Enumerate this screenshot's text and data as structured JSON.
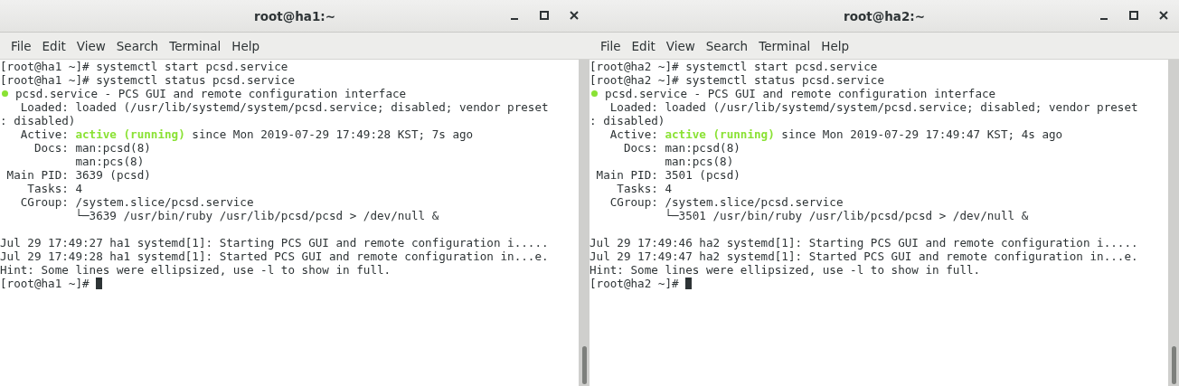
{
  "windows": [
    {
      "title": "root@ha1:~",
      "menu": [
        "File",
        "Edit",
        "View",
        "Search",
        "Terminal",
        "Help"
      ],
      "lines": [
        {
          "kind": "plain",
          "text": "[root@ha1 ~]# systemctl start pcsd.service"
        },
        {
          "kind": "plain",
          "text": "[root@ha1 ~]# systemctl status pcsd.service"
        },
        {
          "kind": "bullet",
          "text": "pcsd.service - PCS GUI and remote configuration interface"
        },
        {
          "kind": "plain",
          "text": "   Loaded: loaded (/usr/lib/systemd/system/pcsd.service; disabled; vendor preset"
        },
        {
          "kind": "plain",
          "text": ": disabled)"
        },
        {
          "kind": "status",
          "label": "   Active: ",
          "state": "active (running)",
          "rest": " since Mon 2019-07-29 17:49:28 KST; 7s ago"
        },
        {
          "kind": "plain",
          "text": "     Docs: man:pcsd(8)"
        },
        {
          "kind": "plain",
          "text": "           man:pcs(8)"
        },
        {
          "kind": "plain",
          "text": " Main PID: 3639 (pcsd)"
        },
        {
          "kind": "plain",
          "text": "    Tasks: 4"
        },
        {
          "kind": "plain",
          "text": "   CGroup: /system.slice/pcsd.service"
        },
        {
          "kind": "plain",
          "text": "           └─3639 /usr/bin/ruby /usr/lib/pcsd/pcsd > /dev/null &"
        },
        {
          "kind": "blank"
        },
        {
          "kind": "plain",
          "text": "Jul 29 17:49:27 ha1 systemd[1]: Starting PCS GUI and remote configuration i....."
        },
        {
          "kind": "plain",
          "text": "Jul 29 17:49:28 ha1 systemd[1]: Started PCS GUI and remote configuration in...e."
        },
        {
          "kind": "plain",
          "text": "Hint: Some lines were ellipsized, use -l to show in full."
        },
        {
          "kind": "prompt",
          "text": "[root@ha1 ~]# "
        }
      ]
    },
    {
      "title": "root@ha2:~",
      "menu": [
        "File",
        "Edit",
        "View",
        "Search",
        "Terminal",
        "Help"
      ],
      "lines": [
        {
          "kind": "plain",
          "text": "[root@ha2 ~]# systemctl start pcsd.service"
        },
        {
          "kind": "plain",
          "text": "[root@ha2 ~]# systemctl status pcsd.service"
        },
        {
          "kind": "bullet",
          "text": "pcsd.service - PCS GUI and remote configuration interface"
        },
        {
          "kind": "plain",
          "text": "   Loaded: loaded (/usr/lib/systemd/system/pcsd.service; disabled; vendor preset"
        },
        {
          "kind": "plain",
          "text": ": disabled)"
        },
        {
          "kind": "status",
          "label": "   Active: ",
          "state": "active (running)",
          "rest": " since Mon 2019-07-29 17:49:47 KST; 4s ago"
        },
        {
          "kind": "plain",
          "text": "     Docs: man:pcsd(8)"
        },
        {
          "kind": "plain",
          "text": "           man:pcs(8)"
        },
        {
          "kind": "plain",
          "text": " Main PID: 3501 (pcsd)"
        },
        {
          "kind": "plain",
          "text": "    Tasks: 4"
        },
        {
          "kind": "plain",
          "text": "   CGroup: /system.slice/pcsd.service"
        },
        {
          "kind": "plain",
          "text": "           └─3501 /usr/bin/ruby /usr/lib/pcsd/pcsd > /dev/null &"
        },
        {
          "kind": "blank"
        },
        {
          "kind": "plain",
          "text": "Jul 29 17:49:46 ha2 systemd[1]: Starting PCS GUI and remote configuration i....."
        },
        {
          "kind": "plain",
          "text": "Jul 29 17:49:47 ha2 systemd[1]: Started PCS GUI and remote configuration in...e."
        },
        {
          "kind": "plain",
          "text": "Hint: Some lines were ellipsized, use -l to show in full."
        },
        {
          "kind": "prompt",
          "text": "[root@ha2 ~]# "
        }
      ]
    }
  ]
}
